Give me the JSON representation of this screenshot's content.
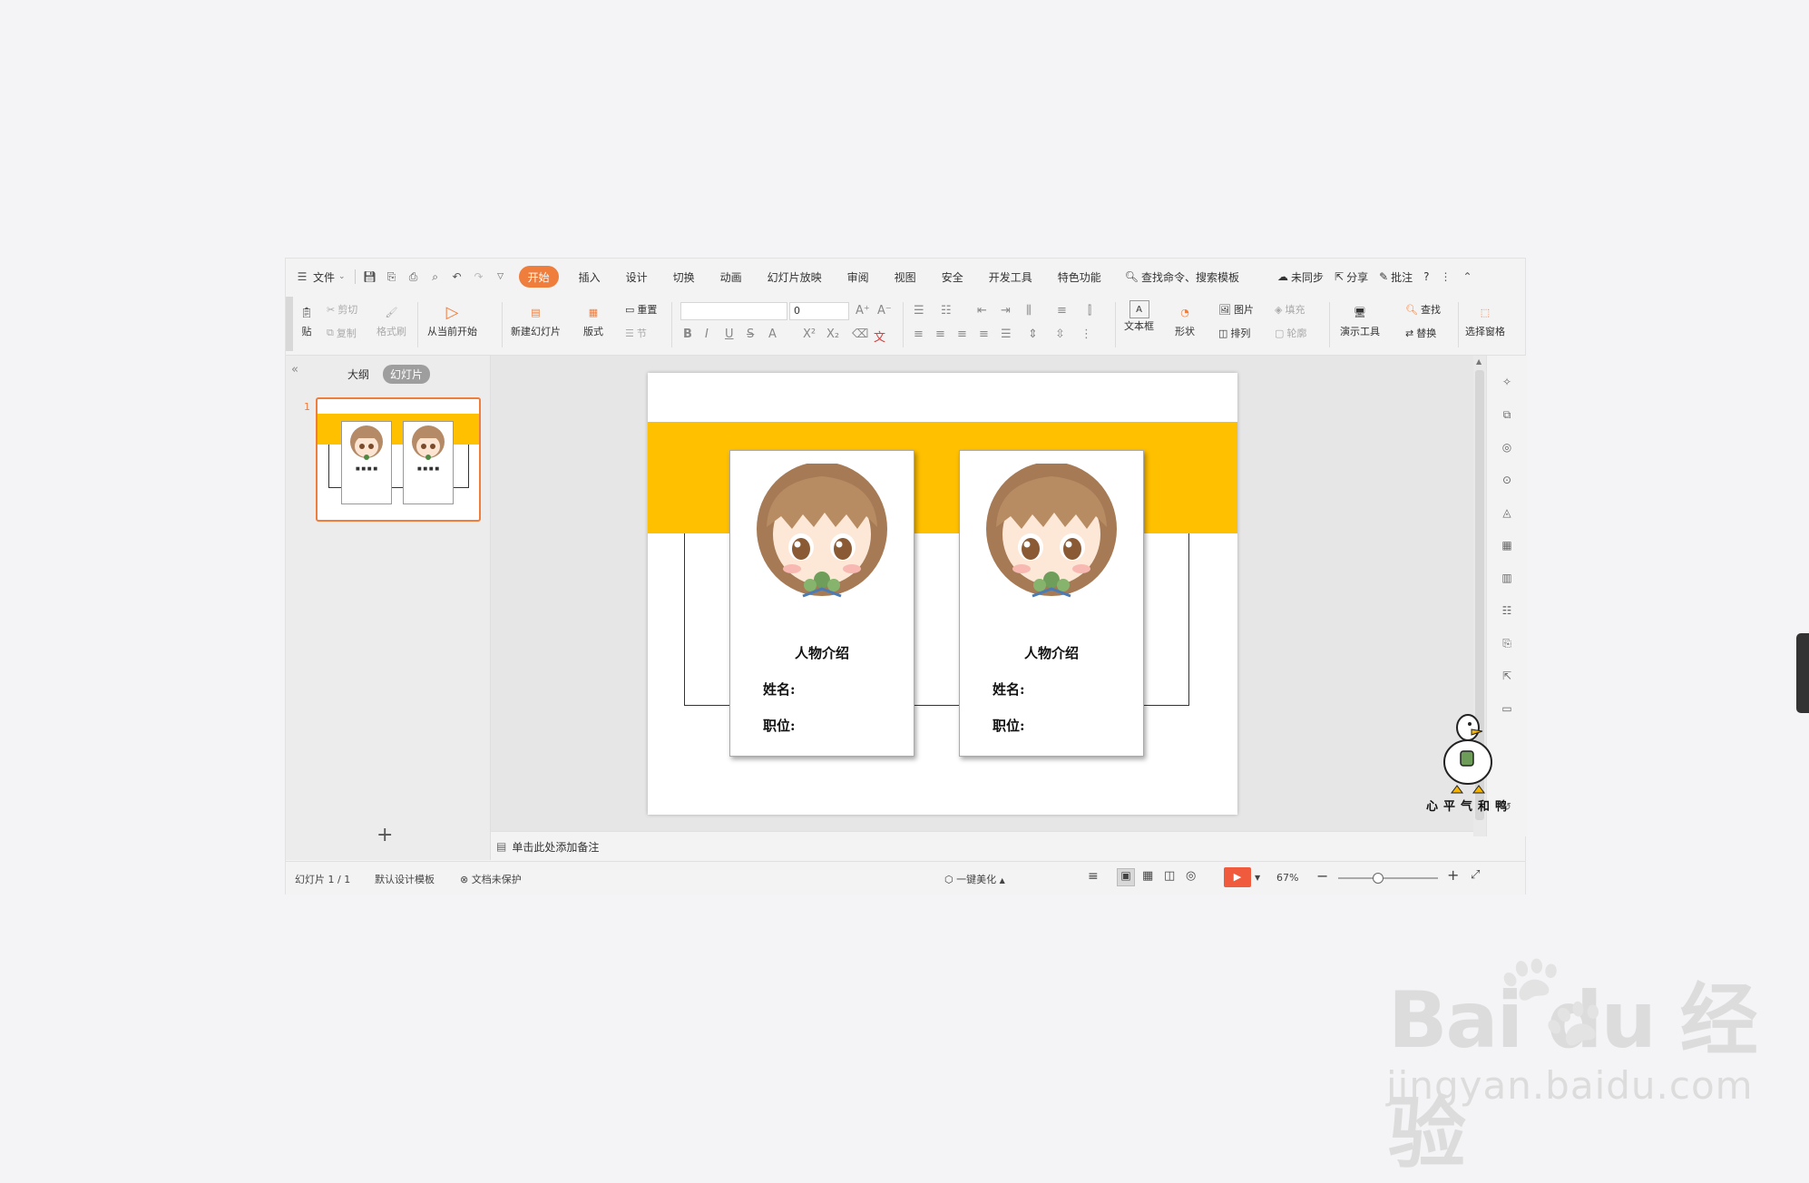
{
  "tabbar": {
    "file_menu": "文件",
    "tabs": [
      "开始",
      "插入",
      "设计",
      "切换",
      "动画",
      "幻灯片放映",
      "审阅",
      "视图",
      "安全",
      "开发工具",
      "特色功能"
    ],
    "search": "查找命令、搜索模板",
    "sync": "未同步",
    "share": "分享",
    "comment": "批注",
    "help": "?"
  },
  "ribbon": {
    "paste": "贴",
    "cut": "剪切",
    "copy": "复制",
    "format_painter": "格式刷",
    "start_from_current": "从当前开始",
    "new_slide": "新建幻灯片",
    "layout": "版式",
    "reset": "重置",
    "section": "节",
    "font_name": "",
    "font_size": "0",
    "text_box": "文本框",
    "shape": "形状",
    "picture": "图片",
    "fill": "填充",
    "arrange": "排列",
    "outline": "轮廓",
    "presentation_tools": "演示工具",
    "find": "查找",
    "replace": "替换",
    "selection_pane": "选择窗格"
  },
  "left_panel": {
    "tab_outline": "大纲",
    "tab_slides": "幻灯片",
    "slide_number": "1",
    "add_button": "+"
  },
  "slide": {
    "band_color": "#ffc000",
    "cards": [
      {
        "title": "人物介绍",
        "name_label": "姓名:",
        "position_label": "职位:"
      },
      {
        "title": "人物介绍",
        "name_label": "姓名:",
        "position_label": "职位:"
      }
    ]
  },
  "notes": {
    "placeholder": "单击此处添加备注"
  },
  "status": {
    "slide_count": "幻灯片 1 / 1",
    "template": "默认设计模板",
    "protection": "文档未保护",
    "beautify": "一键美化",
    "zoom": "67%",
    "zoom_level": 0.67
  },
  "watermark": {
    "logo": "Bai du 经验",
    "url": "jingyan.baidu.com",
    "duck_caption": "心平气和鸭"
  },
  "colors": {
    "accent": "#ef7d3c",
    "slide_band": "#ffc000",
    "play_button": "#ef5b3c"
  }
}
